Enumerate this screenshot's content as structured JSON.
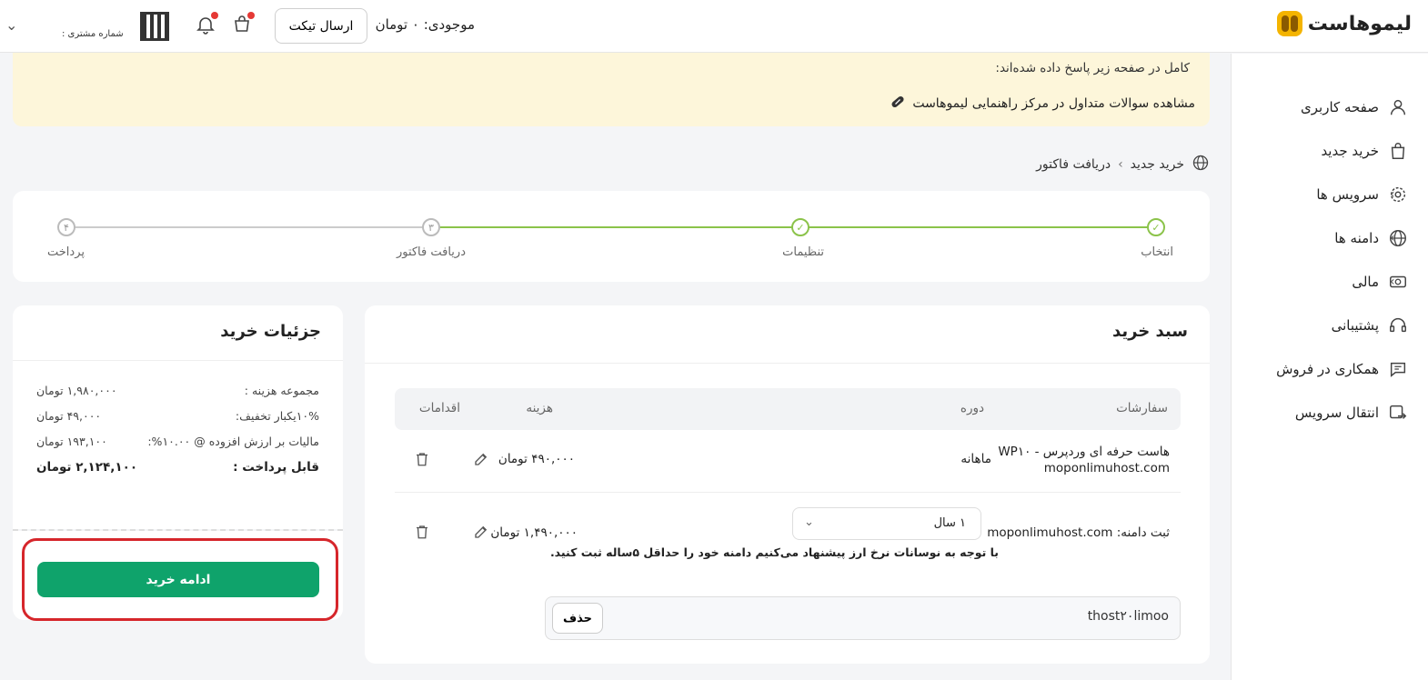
{
  "header": {
    "logo_text": "لیموهاست",
    "balance": "موجودی: ۰ تومان",
    "ticket_button": "ارسال تیکت",
    "customer_label": "شماره مشتری :"
  },
  "sidebar": {
    "items": [
      {
        "label": "صفحه کاربری",
        "icon": "user-icon",
        "has_arrow": false
      },
      {
        "label": "خرید جدید",
        "icon": "bag-icon",
        "has_arrow": false
      },
      {
        "label": "سرویس ها",
        "icon": "gear-icon",
        "has_arrow": true
      },
      {
        "label": "دامنه ها",
        "icon": "globe-icon",
        "has_arrow": true
      },
      {
        "label": "مالی",
        "icon": "money-icon",
        "has_arrow": true
      },
      {
        "label": "پشتیبانی",
        "icon": "headset-icon",
        "has_arrow": false
      },
      {
        "label": "همکاری در فروش",
        "icon": "chat-icon",
        "has_arrow": false
      },
      {
        "label": "انتقال سرویس",
        "icon": "transfer-icon",
        "has_arrow": false
      }
    ]
  },
  "notice": {
    "text": "کامل در صفحه زیر پاسخ داده شده‌اند:",
    "link": "مشاهده سوالات متداول در مرکز راهنمایی لیموهاست"
  },
  "breadcrumb": {
    "first": "خرید جدید",
    "second": "دریافت فاکتور"
  },
  "steps": [
    {
      "label": "انتخاب",
      "number": "۱",
      "done": true
    },
    {
      "label": "تنظیمات",
      "number": "۲",
      "done": true
    },
    {
      "label": "دریافت فاکتور",
      "number": "۳",
      "done": false
    },
    {
      "label": "پرداخت",
      "number": "۴",
      "done": false
    }
  ],
  "cart": {
    "title": "سبد خرید",
    "headers": {
      "orders": "سفارشات",
      "period": "دوره",
      "cost": "هزینه",
      "actions": "اقدامات"
    },
    "rows": [
      {
        "name_line1": "هاست حرفه ای وردپرس - WP۱۰",
        "name_line2": "moponlimuhost.com",
        "period": "ماهانه",
        "cost": "۴۹۰,۰۰۰ تومان"
      },
      {
        "name_line1": "ثبت دامنه: moponlimuhost.com",
        "period_select": "۱ سال",
        "cost": "۱,۴۹۰,۰۰۰ تومان",
        "warning": "با توجه به نوسانات نرخ ارز پیشنهاد می‌کنیم دامنه خود را حداقل ۵ساله ثبت کنید."
      }
    ],
    "promo_code": "thost۲۰limoo",
    "promo_remove": "حذف"
  },
  "details": {
    "title": "جزئیات خرید",
    "rows": [
      {
        "key": "مجموعه هزینه :",
        "value": "۱,۹۸۰,۰۰۰ تومان"
      },
      {
        "key": "۱۰%یکبار تخفیف:",
        "value": "۴۹,۰۰۰ تومان"
      },
      {
        "key": "مالیات بر ارزش افزوده @ ۱۰.۰۰%:",
        "value": "۱۹۳,۱۰۰ تومان"
      },
      {
        "key": "قابل پرداخت :",
        "value": "۲,۱۲۴,۱۰۰ تومان"
      }
    ],
    "continue_button": "ادامه خرید"
  },
  "colors": {
    "accent": "#0fa36b",
    "step_done": "#8bc34a",
    "notice_bg": "#fdf6da",
    "highlight": "#d6262b"
  }
}
